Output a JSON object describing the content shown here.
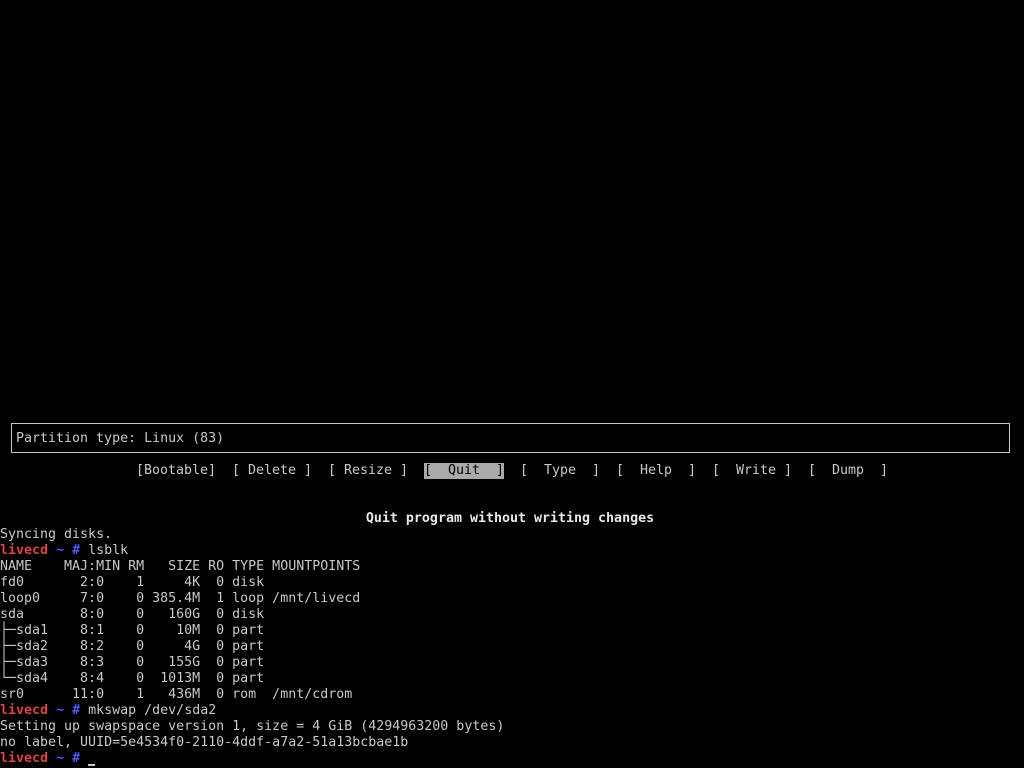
{
  "info_box": {
    "text": "Partition type: Linux (83)"
  },
  "menu": {
    "items": [
      {
        "label": "[Bootable]",
        "selected": false
      },
      {
        "label": "[ Delete ]",
        "selected": false
      },
      {
        "label": "[ Resize ]",
        "selected": false
      },
      {
        "label": "[  Quit  ]",
        "selected": true
      },
      {
        "label": "[  Type  ]",
        "selected": false
      },
      {
        "label": "[  Help  ]",
        "selected": false
      },
      {
        "label": "[  Write ]",
        "selected": false
      },
      {
        "label": "[  Dump  ]",
        "selected": false
      }
    ]
  },
  "hint": "Quit program without writing changes",
  "terminal": {
    "prompt": {
      "host": "livecd",
      "tilde": "~",
      "hash": "#"
    },
    "lines": [
      {
        "type": "output",
        "text": "Syncing disks."
      },
      {
        "type": "prompt",
        "command": "lsblk"
      },
      {
        "type": "output",
        "text": "NAME    MAJ:MIN RM   SIZE RO TYPE MOUNTPOINTS"
      },
      {
        "type": "output",
        "text": "fd0       2:0    1     4K  0 disk"
      },
      {
        "type": "output",
        "text": "loop0     7:0    0 385.4M  1 loop /mnt/livecd"
      },
      {
        "type": "output",
        "text": "sda       8:0    0   160G  0 disk"
      },
      {
        "type": "output",
        "text": "├─sda1    8:1    0    10M  0 part"
      },
      {
        "type": "output",
        "text": "├─sda2    8:2    0     4G  0 part"
      },
      {
        "type": "output",
        "text": "├─sda3    8:3    0   155G  0 part"
      },
      {
        "type": "output",
        "text": "└─sda4    8:4    0  1013M  0 part"
      },
      {
        "type": "output",
        "text": "sr0      11:0    1   436M  0 rom  /mnt/cdrom"
      },
      {
        "type": "prompt",
        "command": "mkswap /dev/sda2"
      },
      {
        "type": "output",
        "text": "Setting up swapspace version 1, size = 4 GiB (4294963200 bytes)"
      },
      {
        "type": "output",
        "text": "no label, UUID=5e4534f0-2110-4ddf-a7a2-51a13bcbae1b"
      },
      {
        "type": "prompt",
        "command": "",
        "cursor": true
      }
    ]
  },
  "colors": {
    "background": "#000000",
    "text": "#c8c8c8",
    "host": "#e04040",
    "prompt_symbol": "#4a5aff",
    "selected_bg": "#aaaaaa"
  }
}
